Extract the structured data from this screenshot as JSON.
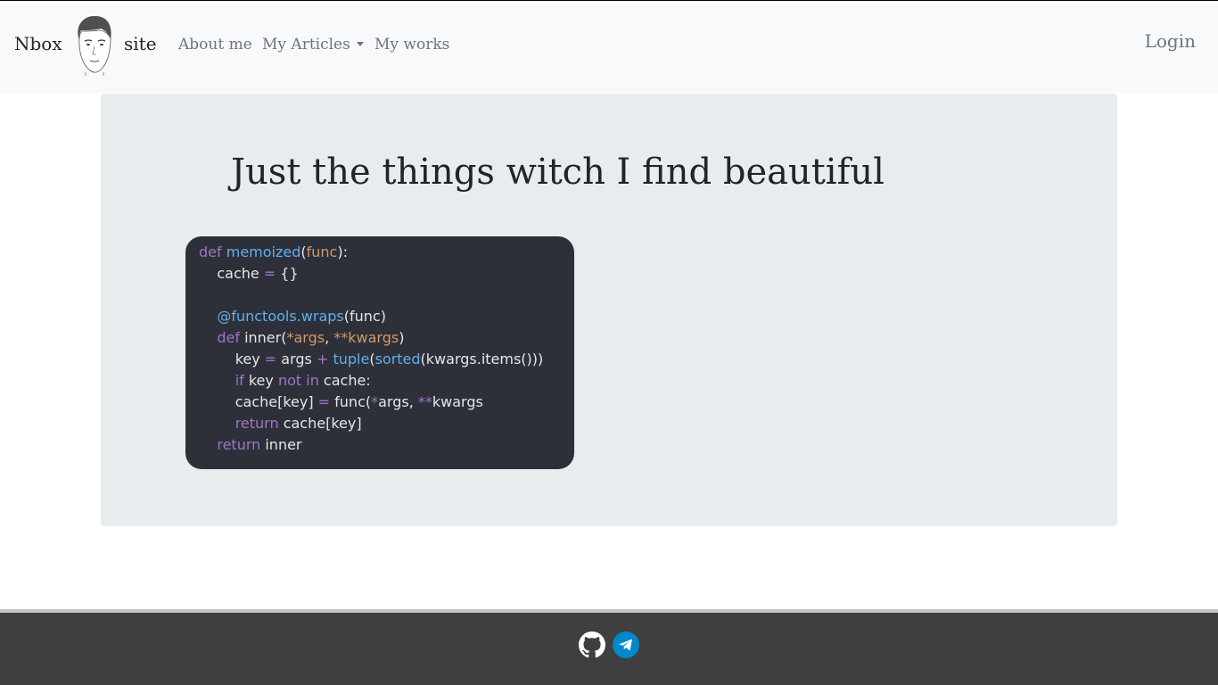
{
  "navbar": {
    "brand_left": "Nbox",
    "brand_right": "site",
    "links": [
      {
        "label": "About me"
      },
      {
        "label": "My Articles",
        "has_dropdown": true
      },
      {
        "label": "My works"
      }
    ],
    "login_label": "Login"
  },
  "main": {
    "headline": "Just the things witch I find beautiful"
  },
  "code": {
    "language": "python",
    "lines": [
      "def memoized(func):",
      "    cache = {}",
      "",
      "    @functools.wraps(func)",
      "    def inner(*args, **kwargs)",
      "        key = args + tuple(sorted(kwargs.items()))",
      "        if key not in cache:",
      "        cache[key] = func(*args, **kwargs",
      "        return cache[key]",
      "    return inner"
    ]
  },
  "footer": {
    "icons": [
      "github-icon",
      "telegram-icon"
    ]
  },
  "colors": {
    "navbar_bg": "#f8f9fa",
    "jumbotron_bg": "#e9ecef",
    "code_bg": "#2d3039",
    "keyword": "#a074c4",
    "function": "#61afef",
    "param": "#d19a66",
    "footer_bg": "#3f3f3f",
    "telegram": "#0088cc"
  }
}
